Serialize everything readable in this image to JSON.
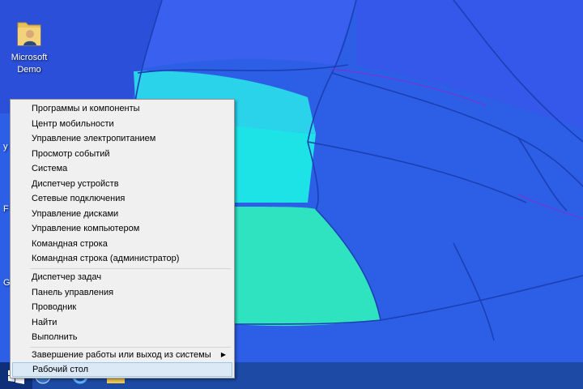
{
  "desktop": {
    "icon_label_line1": "Microsoft",
    "icon_label_line2": "Demo",
    "edge_labels": [
      "y",
      "F",
      "G"
    ]
  },
  "menu": {
    "group1": [
      "Программы и компоненты",
      "Центр мобильности",
      "Управление электропитанием",
      "Просмотр событий",
      "Система",
      "Диспетчер устройств",
      "Сетевые подключения",
      "Управление дисками",
      "Управление компьютером",
      "Командная строка",
      "Командная строка (администратор)"
    ],
    "group2": [
      "Диспетчер задач",
      "Панель управления",
      "Проводник",
      "Найти",
      "Выполнить"
    ],
    "shutdown": "Завершение работы или выход из системы",
    "desktop": "Рабочий стол"
  },
  "icons": {
    "desktop_icon": "folder-user-icon",
    "start": "windows-logo-icon",
    "taskbar": [
      "explorer-icon",
      "ie-icon",
      "file-explorer-icon"
    ],
    "submenu": "chevron-right-icon"
  },
  "colors": {
    "menu_bg": "#f0f0f0",
    "selected_bg": "#dbe9f7",
    "taskbar": "#1846a0"
  }
}
